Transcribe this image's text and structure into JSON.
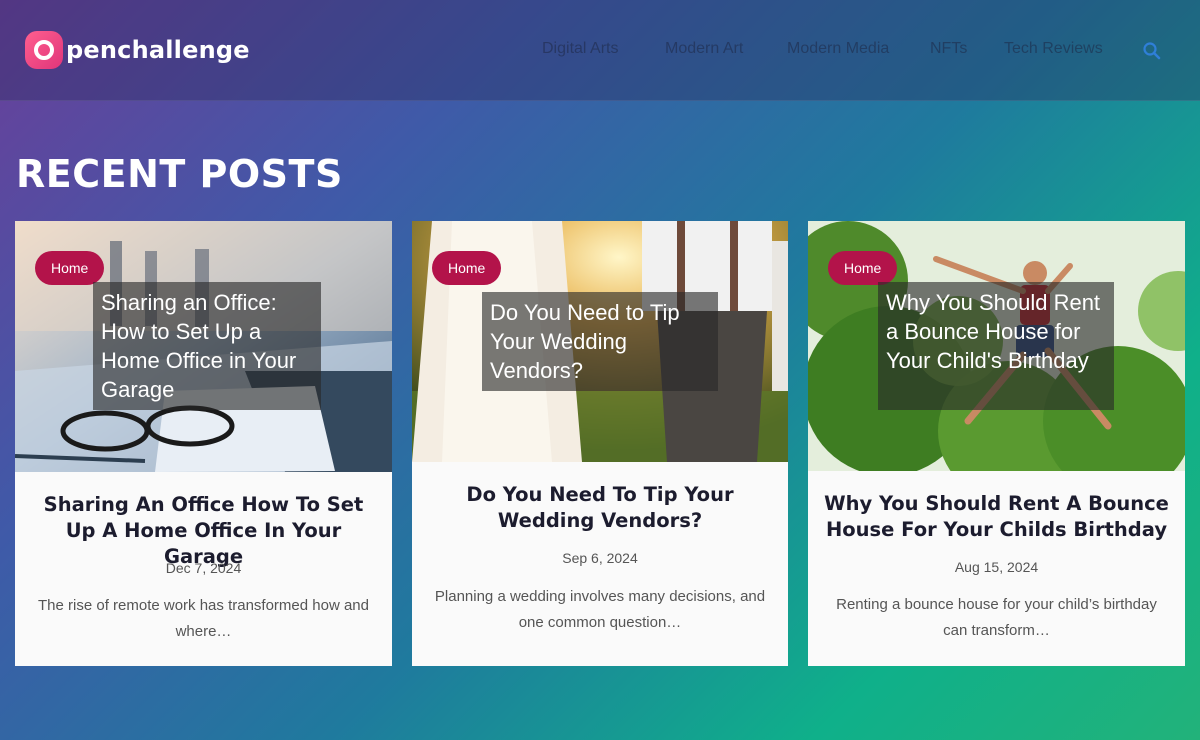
{
  "brand": {
    "logo_text": "penchallenge",
    "accent_color": "#e0357a"
  },
  "nav": {
    "items": [
      "Digital Arts",
      "Modern Art",
      "Modern Media",
      "NFTs",
      "Tech Reviews"
    ],
    "search_icon": "search-icon"
  },
  "section": {
    "title": "RECENT POSTS"
  },
  "posts": [
    {
      "category": "Home",
      "overlay_title": "Sharing an Office: How to Set Up a Home Office in Your Garage",
      "title": "Sharing An Office How To Set Up A Home Office In Your Garage",
      "date": "Dec 7, 2024",
      "excerpt": "The rise of remote work has transformed how and where…"
    },
    {
      "category": "Home",
      "overlay_title": "Do You Need to Tip Your Wedding Vendors?",
      "title": "Do You Need To Tip Your Wedding Vendors?",
      "date": "Sep 6, 2024",
      "excerpt": "Planning a wedding involves many decisions, and one common question…"
    },
    {
      "category": "Home",
      "overlay_title": "Why You Should Rent a Bounce House for Your Child's Birthday",
      "title": "Why You Should Rent A Bounce House For Your Childs Birthday",
      "date": "Aug 15, 2024",
      "excerpt": "Renting a bounce house for your child’s birthday can transform…"
    }
  ],
  "colors": {
    "badge": "#b3134a",
    "card_bg": "#fafafa"
  }
}
